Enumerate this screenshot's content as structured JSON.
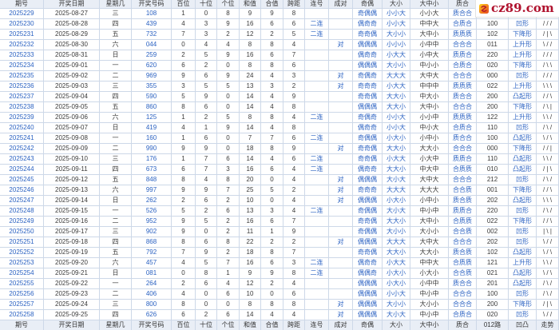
{
  "logo": {
    "text": "cz89.com"
  },
  "colors": {
    "text": "#3a3a3a",
    "link": "#2b62c2",
    "header_bg": "#e9eef6",
    "header_text": "#333333",
    "border": "#cdd8e8",
    "brand": "#b0122e"
  },
  "header": [
    "期号",
    "开奖日期",
    "星期几",
    "开奖号码",
    "百位",
    "十位",
    "个位",
    "和值",
    "合值",
    "跨距",
    "连号",
    "成对",
    "奇偶",
    "大小",
    "大中小",
    "质合",
    "",
    "",
    ""
  ],
  "footer": [
    "期号",
    "开奖日期",
    "星期几",
    "开奖号码",
    "百位",
    "十位",
    "个位",
    "和值",
    "合值",
    "跨距",
    "连号",
    "成对",
    "奇偶",
    "大小",
    "大中小",
    "质合",
    "012路",
    "凹凸",
    "走势"
  ],
  "rows": [
    [
      "2025229",
      "2025-08-27",
      "三",
      "108",
      "1",
      "0",
      "8",
      "9",
      "9",
      "8",
      "",
      "",
      "奇偶偶",
      "小小大",
      "小小大",
      "质合合",
      "",
      "",
      ""
    ],
    [
      "2025230",
      "2025-08-28",
      "四",
      "439",
      "4",
      "3",
      "9",
      "16",
      "6",
      "6",
      "二连",
      "",
      "偶奇奇",
      "小小大",
      "中中大",
      "合质合",
      "100",
      "凹形",
      "/ / /"
    ],
    [
      "2025231",
      "2025-08-29",
      "五",
      "732",
      "7",
      "3",
      "2",
      "12",
      "2",
      "5",
      "二连",
      "",
      "奇奇偶",
      "大小小",
      "大中小",
      "质质质",
      "102",
      "下降形",
      "/ | \\"
    ],
    [
      "2025232",
      "2025-08-30",
      "六",
      "044",
      "0",
      "4",
      "4",
      "8",
      "8",
      "4",
      "",
      "对",
      "偶偶偶",
      "小小小",
      "小中中",
      "合合合",
      "011",
      "上升形",
      "\\ / /"
    ],
    [
      "2025233",
      "2025-08-31",
      "日",
      "259",
      "2",
      "5",
      "9",
      "16",
      "6",
      "7",
      "",
      "",
      "偶奇奇",
      "小大大",
      "小中大",
      "质质合",
      "220",
      "上升形",
      "/ / /"
    ],
    [
      "2025234",
      "2025-09-01",
      "一",
      "620",
      "6",
      "2",
      "0",
      "8",
      "8",
      "6",
      "",
      "",
      "偶偶偶",
      "大小小",
      "中小小",
      "合质合",
      "020",
      "下降形",
      "/ \\ \\"
    ],
    [
      "2025235",
      "2025-09-02",
      "二",
      "969",
      "9",
      "6",
      "9",
      "24",
      "4",
      "3",
      "",
      "对",
      "奇偶奇",
      "大大大",
      "大中大",
      "合合合",
      "000",
      "凹形",
      "/ / /"
    ],
    [
      "2025236",
      "2025-09-03",
      "三",
      "355",
      "3",
      "5",
      "5",
      "13",
      "3",
      "2",
      "",
      "对",
      "奇奇奇",
      "小大大",
      "中中中",
      "质质质",
      "022",
      "上升形",
      "\\ \\ \\"
    ],
    [
      "2025237",
      "2025-09-04",
      "四",
      "590",
      "5",
      "9",
      "0",
      "14",
      "4",
      "9",
      "",
      "",
      "奇奇偶",
      "大大小",
      "中大小",
      "质合合",
      "200",
      "凸起形",
      "/ / \\"
    ],
    [
      "2025238",
      "2025-09-05",
      "五",
      "860",
      "8",
      "6",
      "0",
      "14",
      "4",
      "8",
      "",
      "",
      "偶偶偶",
      "大大小",
      "大中小",
      "合合合",
      "200",
      "下降形",
      "/ \\ |"
    ],
    [
      "2025239",
      "2025-09-06",
      "六",
      "125",
      "1",
      "2",
      "5",
      "8",
      "8",
      "4",
      "二连",
      "",
      "奇偶奇",
      "小小大",
      "小小中",
      "质质质",
      "122",
      "上升形",
      "\\ \\ /"
    ],
    [
      "2025240",
      "2025-09-07",
      "日",
      "419",
      "4",
      "1",
      "9",
      "14",
      "4",
      "8",
      "",
      "",
      "偶奇奇",
      "小小大",
      "中小大",
      "合质合",
      "110",
      "凹形",
      "/ \\ /"
    ],
    [
      "2025241",
      "2025-09-08",
      "一",
      "160",
      "1",
      "6",
      "0",
      "7",
      "7",
      "6",
      "二连",
      "",
      "奇偶偶",
      "小大小",
      "小中小",
      "质合合",
      "100",
      "凸起形",
      "\\ / \\"
    ],
    [
      "2025242",
      "2025-09-09",
      "二",
      "990",
      "9",
      "9",
      "0",
      "18",
      "8",
      "9",
      "",
      "对",
      "奇奇偶",
      "大大小",
      "大大小",
      "合合合",
      "000",
      "下降形",
      "/ / |"
    ],
    [
      "2025243",
      "2025-09-10",
      "三",
      "176",
      "1",
      "7",
      "6",
      "14",
      "4",
      "6",
      "二连",
      "",
      "奇奇偶",
      "小大大",
      "小大中",
      "质质合",
      "110",
      "凸起形",
      "\\ \\ /"
    ],
    [
      "2025244",
      "2025-09-11",
      "四",
      "673",
      "6",
      "7",
      "3",
      "16",
      "6",
      "4",
      "二连",
      "",
      "偶奇奇",
      "大大小",
      "中大中",
      "合质质",
      "010",
      "凸起形",
      "/ | \\"
    ],
    [
      "2025245",
      "2025-09-12",
      "五",
      "848",
      "8",
      "4",
      "8",
      "20",
      "0",
      "4",
      "",
      "对",
      "偶偶偶",
      "大小大",
      "大中大",
      "合合合",
      "212",
      "凹形",
      "/ \\ /"
    ],
    [
      "2025246",
      "2025-09-13",
      "六",
      "997",
      "9",
      "9",
      "7",
      "25",
      "5",
      "2",
      "",
      "对",
      "奇奇奇",
      "大大大",
      "大大大",
      "合合质",
      "001",
      "下降形",
      "/ / \\"
    ],
    [
      "2025247",
      "2025-09-14",
      "日",
      "262",
      "2",
      "6",
      "2",
      "10",
      "0",
      "4",
      "",
      "对",
      "偶偶偶",
      "小大小",
      "小中小",
      "质合质",
      "202",
      "凸起形",
      "\\ \\ \\"
    ],
    [
      "2025248",
      "2025-09-15",
      "一",
      "526",
      "5",
      "2",
      "6",
      "13",
      "3",
      "4",
      "二连",
      "",
      "奇偶偶",
      "大小大",
      "中小中",
      "质质合",
      "220",
      "凹形",
      "/ \\ /"
    ],
    [
      "2025249",
      "2025-09-16",
      "二",
      "952",
      "9",
      "5",
      "2",
      "16",
      "6",
      "7",
      "",
      "",
      "奇奇偶",
      "大大小",
      "大中小",
      "合质质",
      "022",
      "下降形",
      "/ / \\"
    ],
    [
      "2025250",
      "2025-09-17",
      "三",
      "902",
      "9",
      "0",
      "2",
      "11",
      "1",
      "9",
      "",
      "",
      "奇偶偶",
      "大小小",
      "大小小",
      "合合质",
      "002",
      "凹形",
      "| \\ |"
    ],
    [
      "2025251",
      "2025-09-18",
      "四",
      "868",
      "8",
      "6",
      "8",
      "22",
      "2",
      "2",
      "",
      "对",
      "偶偶偶",
      "大大大",
      "大中大",
      "合合合",
      "202",
      "凹形",
      "\\ / /"
    ],
    [
      "2025252",
      "2025-09-19",
      "五",
      "792",
      "7",
      "9",
      "2",
      "18",
      "8",
      "7",
      "",
      "",
      "奇奇偶",
      "大大小",
      "大大小",
      "质合质",
      "102",
      "凸起形",
      "\\ / \\"
    ],
    [
      "2025253",
      "2025-09-20",
      "六",
      "457",
      "4",
      "5",
      "7",
      "16",
      "6",
      "3",
      "二连",
      "",
      "偶奇奇",
      "小大大",
      "中中大",
      "合质质",
      "121",
      "上升形",
      "\\ \\ /"
    ],
    [
      "2025254",
      "2025-09-21",
      "日",
      "081",
      "0",
      "8",
      "1",
      "9",
      "9",
      "8",
      "二连",
      "",
      "偶偶奇",
      "小大小",
      "小大小",
      "合合质",
      "021",
      "凸起形",
      "\\ / \\"
    ],
    [
      "2025255",
      "2025-09-22",
      "一",
      "264",
      "2",
      "6",
      "4",
      "12",
      "2",
      "4",
      "",
      "",
      "偶偶偶",
      "小大小",
      "小中中",
      "质合合",
      "201",
      "凸起形",
      "/ \\ /"
    ],
    [
      "2025256",
      "2025-09-23",
      "二",
      "406",
      "4",
      "0",
      "6",
      "10",
      "0",
      "6",
      "",
      "",
      "偶偶偶",
      "小小大",
      "中小中",
      "合合合",
      "100",
      "凹形",
      "/ \\ /"
    ],
    [
      "2025257",
      "2025-09-24",
      "三",
      "800",
      "8",
      "0",
      "0",
      "8",
      "8",
      "8",
      "",
      "对",
      "偶偶偶",
      "大小小",
      "大小小",
      "合合合",
      "200",
      "下降形",
      "/ | \\"
    ],
    [
      "2025258",
      "2025-09-25",
      "四",
      "626",
      "6",
      "2",
      "6",
      "14",
      "4",
      "4",
      "",
      "对",
      "偶偶偶",
      "大小大",
      "中小中",
      "合质合",
      "020",
      "凹形",
      "\\ / /"
    ]
  ]
}
